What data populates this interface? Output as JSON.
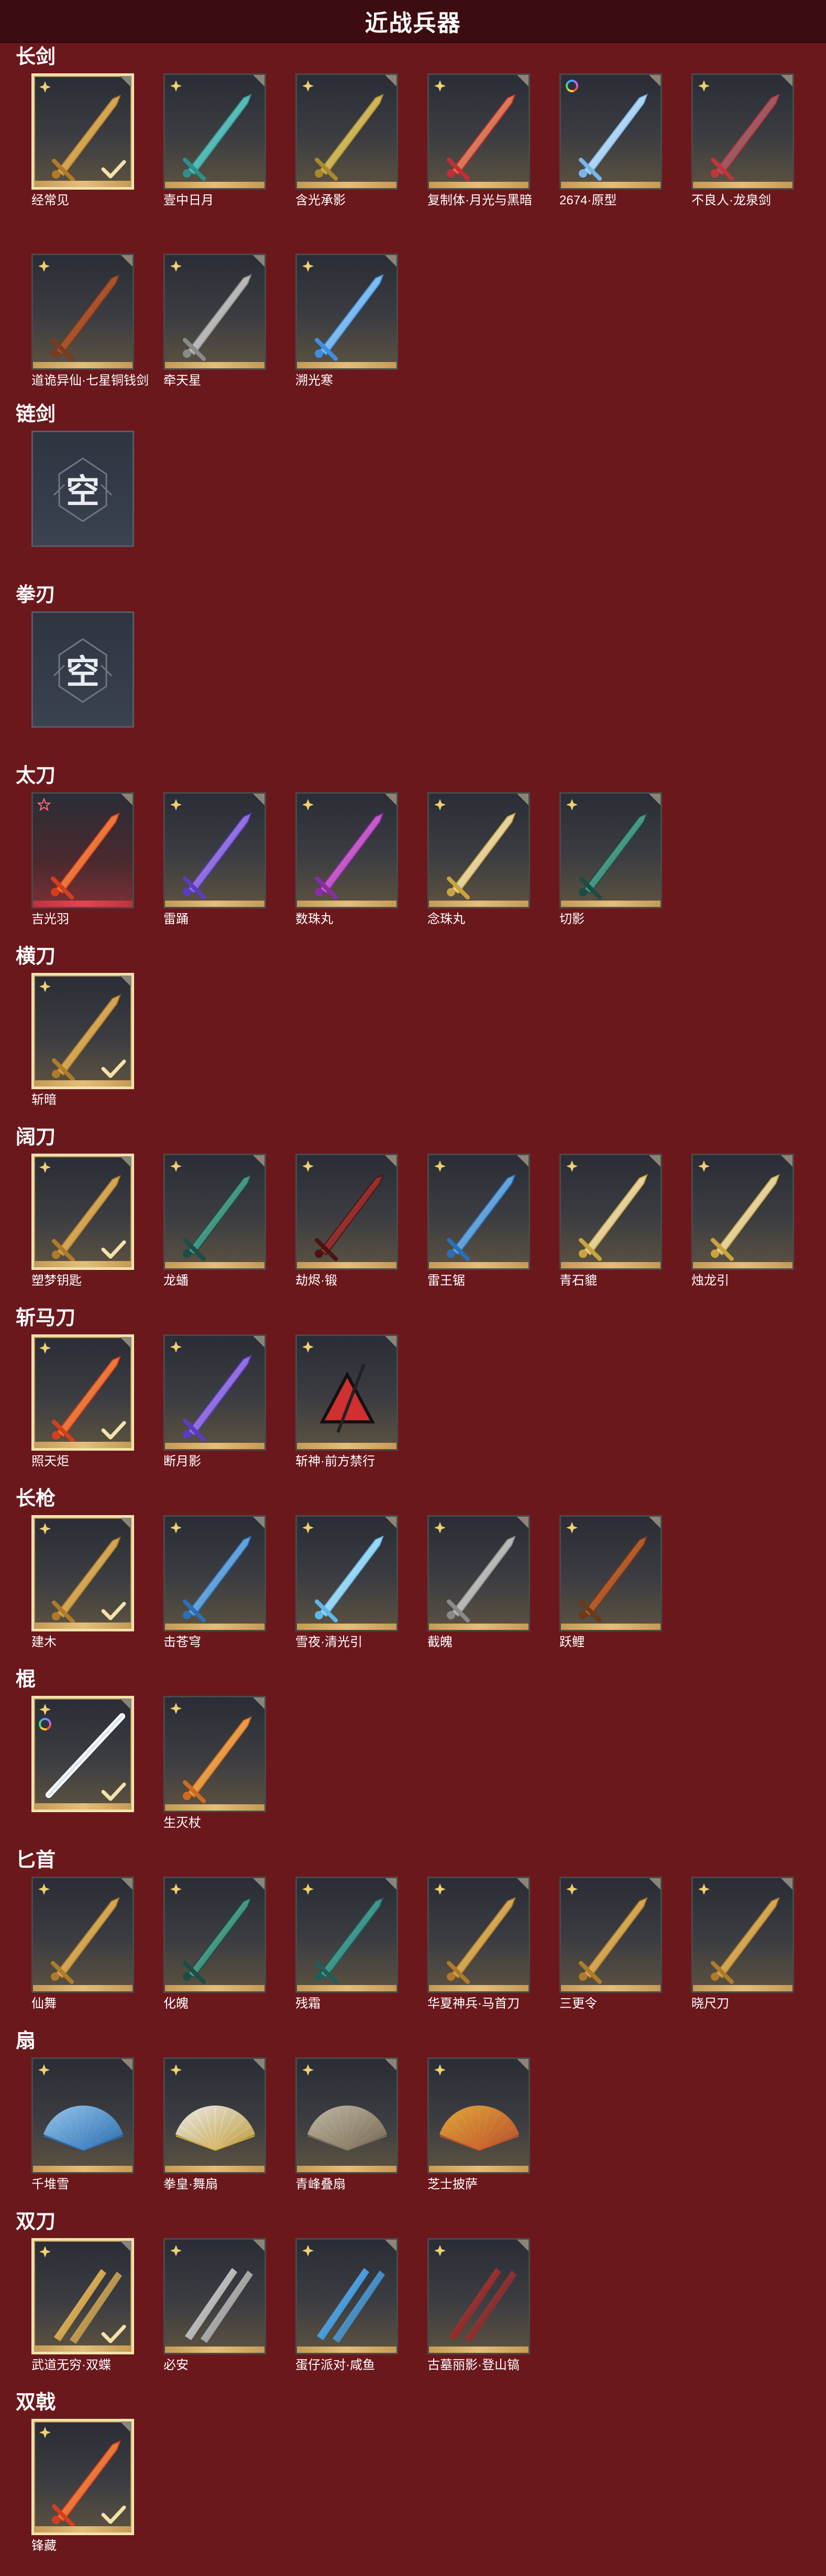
{
  "header": {
    "title": "近战兵器"
  },
  "sections": [
    {
      "title": "长剑",
      "items": [
        {
          "name": "经常见",
          "badge": "gold",
          "selected": true,
          "check": true,
          "art": "sword-gold"
        },
        {
          "name": "壹中日月",
          "badge": "gold",
          "art": "sword-cyan"
        },
        {
          "name": "含光承影",
          "badge": "gold",
          "art": "sword-yellow"
        },
        {
          "name": "复制体·月光与黑暗",
          "badge": "gold",
          "art": "sword-ring"
        },
        {
          "name": "2674·原型",
          "badge": "rainbow",
          "art": "sword-light"
        },
        {
          "name": "不良人·龙泉剑",
          "badge": "gold",
          "art": "sword-dark"
        },
        {
          "name": "道诡异仙·七星铜钱剑",
          "badge": "gold",
          "art": "sword-coin"
        },
        {
          "name": "牵天星",
          "badge": "gold",
          "art": "sword-silver"
        },
        {
          "name": "溯光寒",
          "badge": "gold",
          "art": "sword-ice"
        }
      ]
    },
    {
      "title": "链剑",
      "empty": true,
      "empty_text": "空"
    },
    {
      "title": "拳刃",
      "empty": true,
      "empty_text": "空"
    },
    {
      "title": "太刀",
      "items": [
        {
          "name": "吉光羽",
          "badge": "red",
          "red": true,
          "art": "blade-fire"
        },
        {
          "name": "雷踊",
          "badge": "gold",
          "art": "blade-purple"
        },
        {
          "name": "数珠丸",
          "badge": "gold",
          "art": "blade-pink"
        },
        {
          "name": "念珠丸",
          "badge": "gold",
          "art": "blade-white"
        },
        {
          "name": "切影",
          "badge": "gold",
          "art": "blade-green"
        }
      ]
    },
    {
      "title": "横刀",
      "items": [
        {
          "name": "斩暗",
          "badge": "gold",
          "selected": true,
          "check": true,
          "art": "hengdao"
        }
      ]
    },
    {
      "title": "阔刀",
      "items": [
        {
          "name": "塑梦钥匙",
          "badge": "gold",
          "selected": true,
          "check": true,
          "art": "broad-gold"
        },
        {
          "name": "龙蟠",
          "badge": "gold",
          "art": "broad-green"
        },
        {
          "name": "劫烬·锻",
          "badge": "gold",
          "art": "broad-red"
        },
        {
          "name": "雷王锯",
          "badge": "gold",
          "art": "broad-blue"
        },
        {
          "name": "青石貔",
          "badge": "gold",
          "art": "broad-white"
        },
        {
          "name": "烛龙引",
          "badge": "gold",
          "art": "broad-white2"
        }
      ]
    },
    {
      "title": "斩马刀",
      "items": [
        {
          "name": "照天炬",
          "badge": "gold",
          "selected": true,
          "check": true,
          "art": "zhan-fire"
        },
        {
          "name": "断月影",
          "badge": "gold",
          "art": "zhan-purple"
        },
        {
          "name": "斩神·前方禁行",
          "badge": "gold",
          "art": "zhan-sign"
        }
      ]
    },
    {
      "title": "长枪",
      "items": [
        {
          "name": "建木",
          "badge": "gold",
          "selected": true,
          "check": true,
          "art": "spear-gold"
        },
        {
          "name": "击苍穹",
          "badge": "gold",
          "art": "spear-blue"
        },
        {
          "name": "雪夜·清光引",
          "badge": "gold",
          "art": "spear-snow"
        },
        {
          "name": "截魄",
          "badge": "gold",
          "art": "spear-silver"
        },
        {
          "name": "跃鲤",
          "badge": "gold",
          "art": "spear-koi"
        }
      ]
    },
    {
      "title": "棍",
      "items": [
        {
          "name": "",
          "badge": "gold",
          "rainbow_extra": true,
          "selected": true,
          "check": true,
          "art": "staff-light"
        },
        {
          "name": "生灭杖",
          "badge": "gold",
          "art": "staff-flame"
        }
      ]
    },
    {
      "title": "匕首",
      "items": [
        {
          "name": "仙舞",
          "badge": "gold",
          "art": "dagger-1"
        },
        {
          "name": "化魄",
          "badge": "gold",
          "art": "dagger-green"
        },
        {
          "name": "残霜",
          "badge": "gold",
          "art": "dagger-teal"
        },
        {
          "name": "华夏神兵·马首刀",
          "badge": "gold",
          "art": "dagger-horse"
        },
        {
          "name": "三更令",
          "badge": "gold",
          "art": "dagger-ornate"
        },
        {
          "name": "晓尺刀",
          "badge": "gold",
          "art": "dagger-gold"
        }
      ]
    },
    {
      "title": "扇",
      "items": [
        {
          "name": "千堆雪",
          "badge": "gold",
          "art": "fan-blue"
        },
        {
          "name": "拳皇·舞扇",
          "badge": "gold",
          "art": "fan-white"
        },
        {
          "name": "青峰叠扇",
          "badge": "gold",
          "art": "fan-stone"
        },
        {
          "name": "芝士披萨",
          "badge": "gold",
          "art": "fan-pizza"
        }
      ]
    },
    {
      "title": "双刀",
      "items": [
        {
          "name": "武道无穷·双蝶",
          "badge": "gold",
          "selected": true,
          "check": true,
          "art": "dual-gold"
        },
        {
          "name": "必安",
          "badge": "gold",
          "art": "dual-silver"
        },
        {
          "name": "蛋仔派对·咸鱼",
          "badge": "gold",
          "art": "dual-fish"
        },
        {
          "name": "古墓丽影·登山镐",
          "badge": "gold",
          "art": "dual-red"
        }
      ]
    },
    {
      "title": "双戟",
      "items": [
        {
          "name": "锋藏",
          "badge": "gold",
          "selected": true,
          "check": true,
          "art": "ji-fire"
        }
      ]
    }
  ]
}
